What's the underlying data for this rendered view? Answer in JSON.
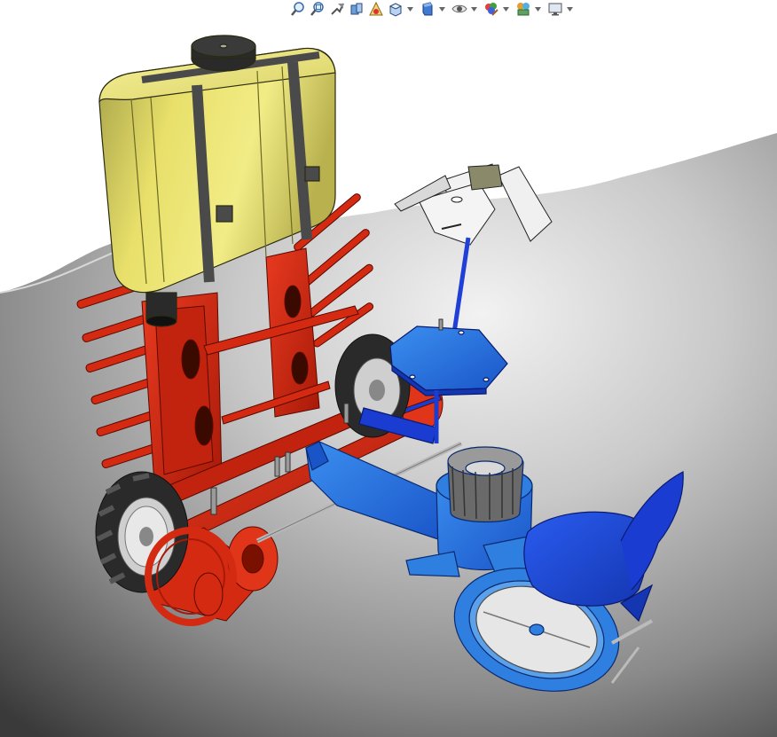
{
  "app": {
    "type": "CAD 3D model viewport"
  },
  "toolbar": {
    "items": [
      {
        "icon": "zoom-to-fit-icon",
        "has_dropdown": false
      },
      {
        "icon": "zoom-to-area-icon",
        "has_dropdown": false
      },
      {
        "icon": "previous-view-icon",
        "has_dropdown": false
      },
      {
        "icon": "section-view-icon",
        "has_dropdown": false
      },
      {
        "icon": "dynamic-annotation-views-icon",
        "has_dropdown": false
      },
      {
        "icon": "view-orientation-icon",
        "has_dropdown": true
      },
      {
        "icon": "display-style-icon",
        "has_dropdown": true
      },
      {
        "icon": "hide-show-items-icon",
        "has_dropdown": true
      },
      {
        "icon": "edit-appearance-icon",
        "has_dropdown": true
      },
      {
        "icon": "apply-scene-icon",
        "has_dropdown": true
      },
      {
        "icon": "view-settings-monitor-icon",
        "has_dropdown": true
      }
    ]
  },
  "model": {
    "parts": [
      {
        "name": "water-tank",
        "color": "#e8e06a"
      },
      {
        "name": "tank-straps",
        "color": "#4a4a4a"
      },
      {
        "name": "red-frame",
        "color": "#d42a12"
      },
      {
        "name": "drive-wheels",
        "color": "#2a2a2a"
      },
      {
        "name": "seedling-tray",
        "color": "#f2f2f2"
      },
      {
        "name": "blue-platform",
        "color": "#1f4fe8"
      },
      {
        "name": "planter-unit",
        "color": "#2f7fe0"
      },
      {
        "name": "seat",
        "color": "#1f4fe8"
      }
    ]
  },
  "colors": {
    "background": "#ffffff",
    "floor_light": "#9a9a9a",
    "floor_dark": "#3c3c3c"
  }
}
